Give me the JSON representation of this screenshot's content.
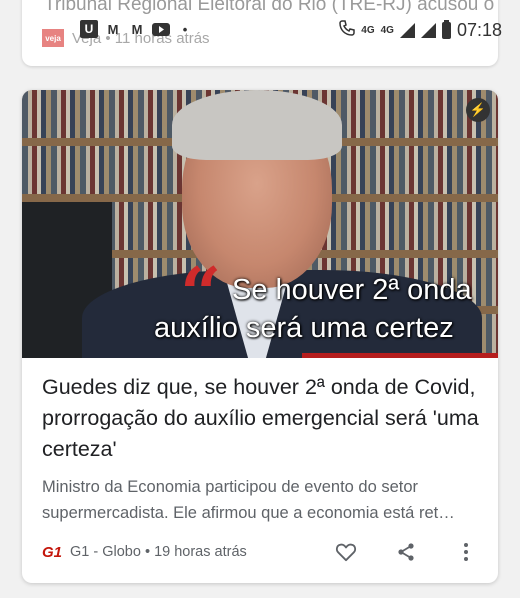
{
  "status_bar": {
    "left_icons": [
      "U",
      "M",
      "M",
      "youtube"
    ],
    "network_1": "4G",
    "network_2": "4G",
    "time": "07:18"
  },
  "prev_card": {
    "cut_text": "Tribunal Regional Eleitoral do Rio (TRE-RJ) acusou o ...",
    "source_logo": "veja",
    "source_meta": "Veja • 11 horas atrás"
  },
  "card": {
    "caption_line1": "Se houver 2ª onda",
    "caption_line2": "auxílio será uma certez",
    "headline": "Guedes diz que, se houver 2ª onda de Covid, prorrogação do auxílio emergencial será 'uma certeza'",
    "summary": "Ministro da Economia participou de evento do setor supermercadista. Ele afirmou que a economia está ret…",
    "source_logo": "G1",
    "source_meta": "G1 - Globo • 19 horas atrás"
  },
  "colors": {
    "accent_red": "#cf2b2b",
    "g1_red": "#c4170c"
  }
}
